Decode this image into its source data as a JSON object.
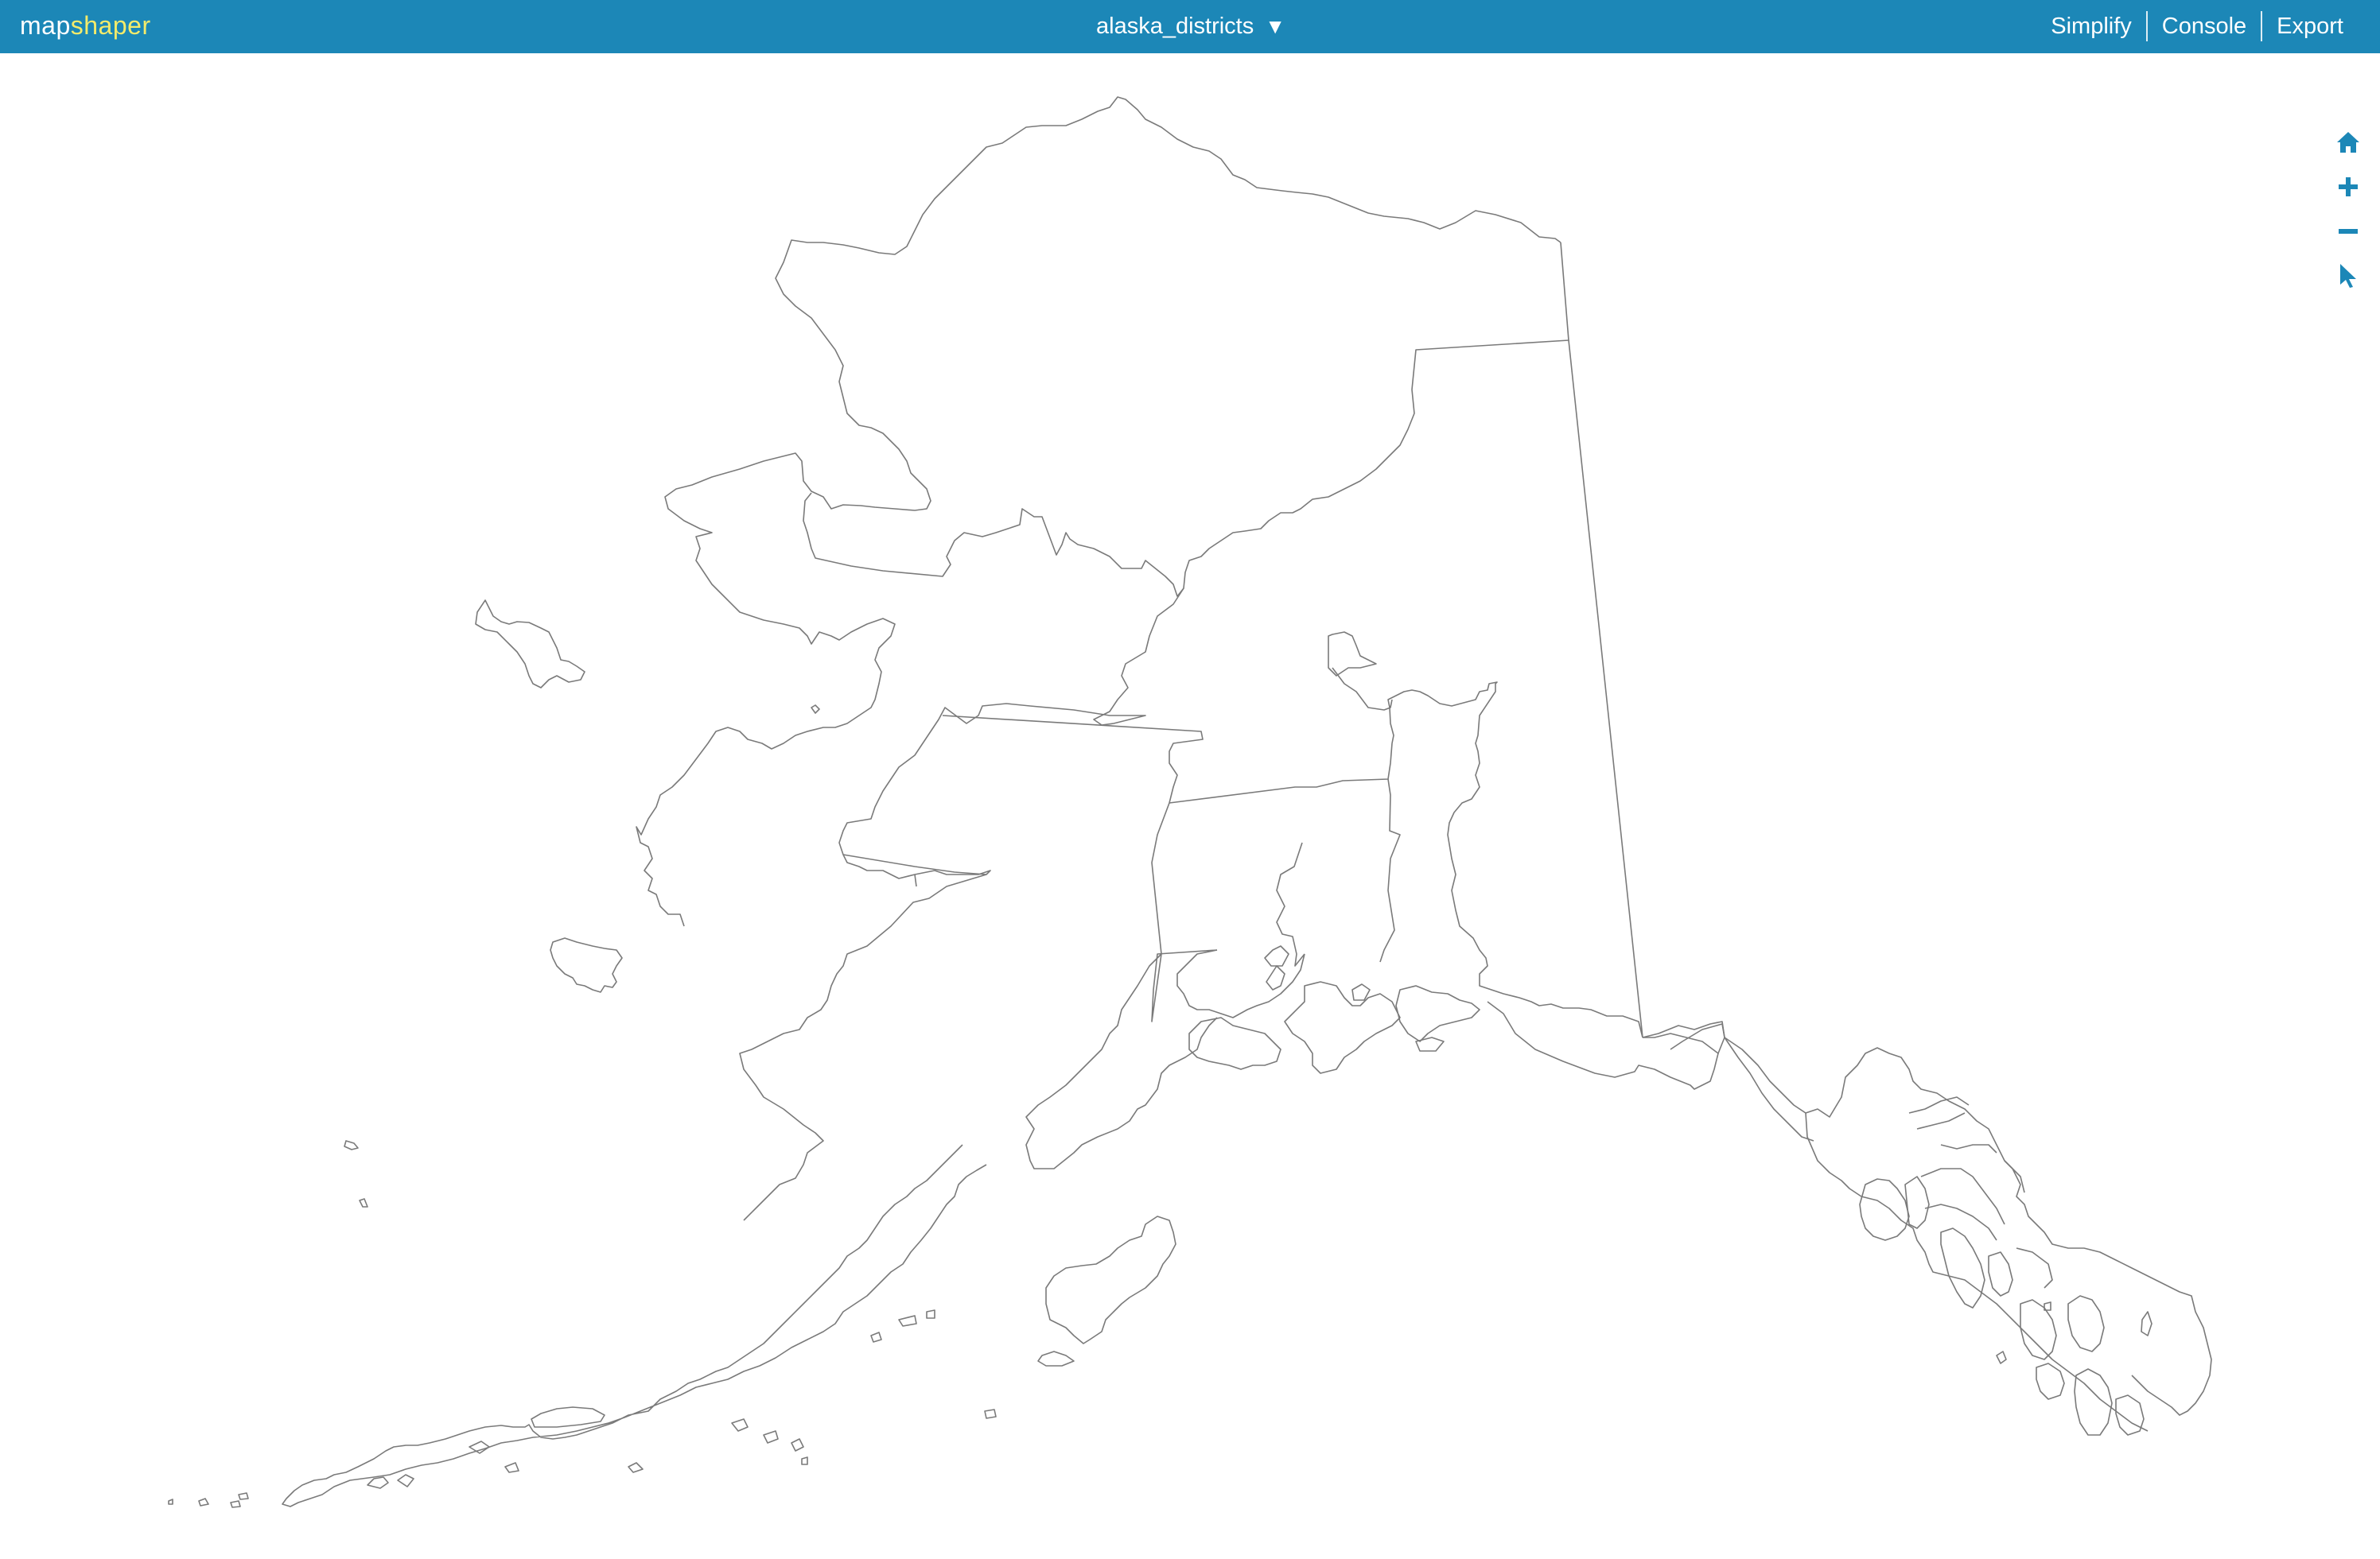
{
  "app": {
    "logo_part1": "map",
    "logo_part2": "shaper"
  },
  "layer_menu": {
    "label": "alaska_districts",
    "caret": "▼"
  },
  "nav": {
    "simplify": "Simplify",
    "console": "Console",
    "export": "Export"
  },
  "tools": [
    {
      "name": "home-icon"
    },
    {
      "name": "zoom-in-icon"
    },
    {
      "name": "zoom-out-icon"
    },
    {
      "name": "select-pointer-icon"
    }
  ],
  "colors": {
    "header": "#1c87b7",
    "logo_accent": "#f4eb6a",
    "outline": "#7a7a7a"
  }
}
